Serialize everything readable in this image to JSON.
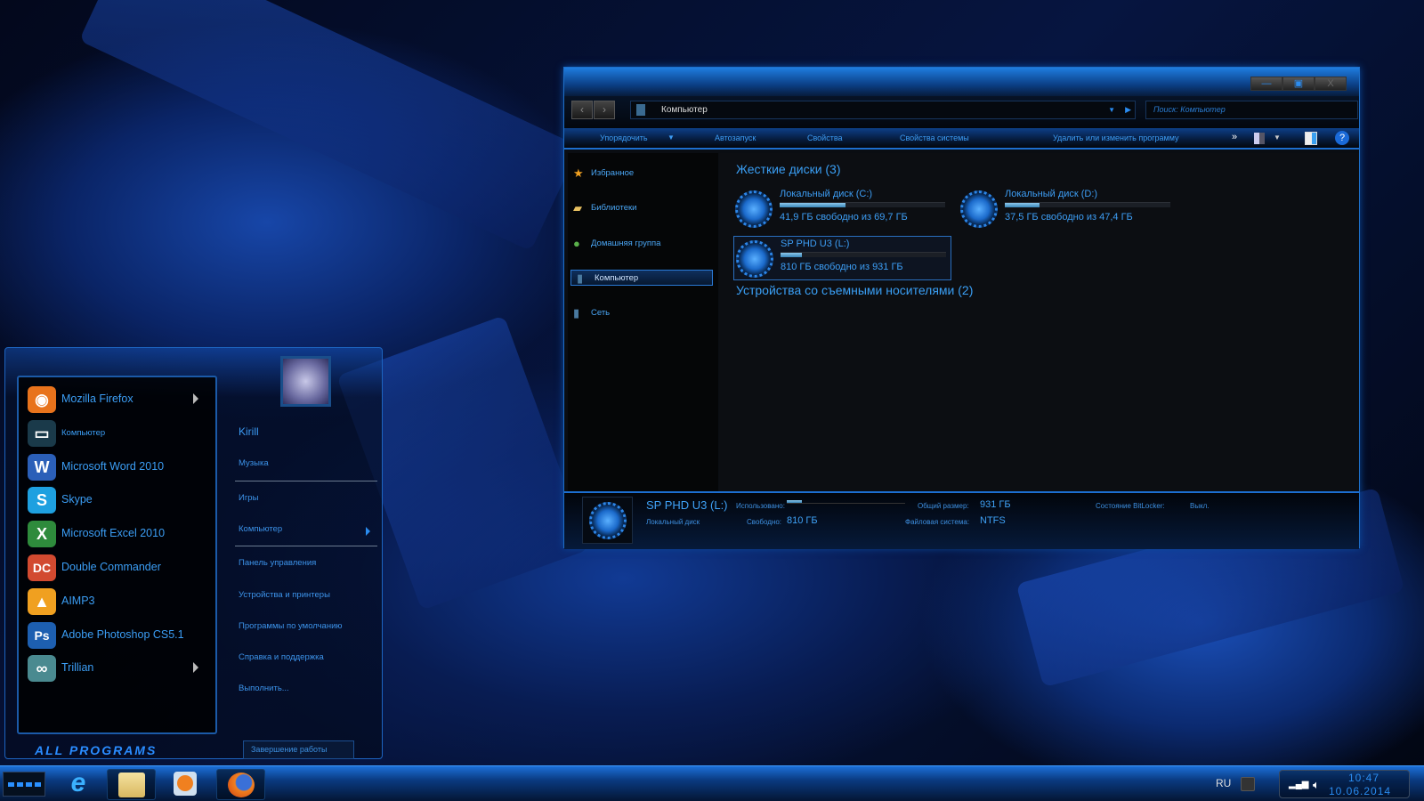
{
  "desktop": {
    "accent": "#1c6ed0"
  },
  "explorer": {
    "address": "Компьютер",
    "search_placeholder": "Поиск: Компьютер",
    "controls": {
      "minimize": "—",
      "maximize": "▣",
      "close": "X"
    },
    "toolbar": [
      "Упорядочить",
      "Автозапуск",
      "Свойства",
      "Свойства системы",
      "Удалить или изменить программу"
    ],
    "toolbar_more": "»",
    "nav": [
      {
        "label": "Избранное",
        "icon": "star-icon"
      },
      {
        "label": "Библиотеки",
        "icon": "folder-icon"
      },
      {
        "label": "Домашняя группа",
        "icon": "homegroup-icon"
      },
      {
        "label": "Компьютер",
        "icon": "computer-icon",
        "selected": true
      },
      {
        "label": "Сеть",
        "icon": "network-icon"
      }
    ],
    "groups": {
      "hard": "Жесткие диски (3)",
      "removable": "Устройства со съемными носителями (2)"
    },
    "drives": [
      {
        "name": "Локальный диск (C:)",
        "free": "41,9 ГБ свободно из 69,7 ГБ",
        "used_fraction": 0.4
      },
      {
        "name": "Локальный диск (D:)",
        "free": "37,5 ГБ свободно из 47,4 ГБ",
        "used_fraction": 0.21
      },
      {
        "name": "SP PHD U3 (L:)",
        "free": "810 ГБ свободно из 931 ГБ",
        "used_fraction": 0.13,
        "selected": true
      }
    ],
    "details": {
      "name": "SP PHD U3 (L:)",
      "type": "Локальный диск",
      "used_label": "Использовано:",
      "used_fraction": 0.13,
      "free_label": "Свободно:",
      "free": "810 ГБ",
      "total_label": "Общий размер:",
      "total": "931 ГБ",
      "fs_label": "Файловая система:",
      "fs": "NTFS",
      "bitlocker_label": "Состояние BitLocker:",
      "bitlocker": "Выкл."
    }
  },
  "start_menu": {
    "programs": [
      {
        "label": "Mozilla Firefox",
        "arrow": true,
        "color": "#e8731c",
        "glyph": "◉"
      },
      {
        "label": "Компьютер",
        "small": true,
        "color": "#1a3a4a",
        "glyph": "▭"
      },
      {
        "label": "Microsoft Word 2010",
        "color": "#2b5fb8",
        "glyph": "W"
      },
      {
        "label": "Skype",
        "color": "#1ea0e0",
        "glyph": "S"
      },
      {
        "label": "Microsoft Excel 2010",
        "color": "#2e8b3c",
        "glyph": "X"
      },
      {
        "label": "Double Commander",
        "color": "#d24a30",
        "glyph": "DC"
      },
      {
        "label": "AIMP3",
        "color": "#f0a020",
        "glyph": "▲"
      },
      {
        "label": "Adobe Photoshop CS5.1",
        "color": "#1d5fb0",
        "glyph": "Ps"
      },
      {
        "label": "Trillian",
        "arrow": true,
        "color": "#4a8a90",
        "glyph": "∞"
      }
    ],
    "user": "Kirill",
    "links": [
      "Музыка",
      "Игры",
      "Компьютер",
      "Панель управления",
      "Устройства и принтеры",
      "Программы по умолчанию",
      "Справка и поддержка",
      "Выполнить..."
    ],
    "all_programs": "ALL PROGRAMS",
    "shutdown": "Завершение работы"
  },
  "taskbar": {
    "apps": [
      "internet-explorer",
      "file-explorer",
      "media-player",
      "firefox"
    ],
    "lang": "RU",
    "time": "10:47",
    "date": "10.06.2014"
  }
}
